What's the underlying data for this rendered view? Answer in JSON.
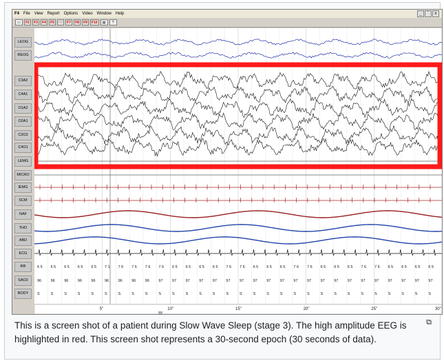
{
  "app": {
    "logo": "F4",
    "menu": [
      "File",
      "View",
      "Report",
      "Options",
      "Video",
      "Window",
      "Help"
    ],
    "window_controls": [
      "_",
      "´",
      "x"
    ],
    "toolbar": [
      {
        "label": "F2",
        "style": "red"
      },
      {
        "label": "F3",
        "style": "red"
      },
      {
        "label": "F4",
        "style": "red"
      },
      {
        "label": "F5",
        "style": "red"
      },
      {
        "label": "F6",
        "style": "gray"
      },
      {
        "label": "F7",
        "style": "red"
      },
      {
        "label": "F8",
        "style": "red"
      },
      {
        "label": "F9",
        "style": "red"
      },
      {
        "label": "F10",
        "style": "red"
      }
    ]
  },
  "channels": [
    {
      "label": "LEOG",
      "color": "#2233aa",
      "type": "eog"
    },
    {
      "label": "REOG",
      "color": "#2233aa",
      "type": "eog"
    },
    {
      "label": "C3A2",
      "color": "#111111",
      "type": "eeg"
    },
    {
      "label": "C4A1",
      "color": "#111111",
      "type": "eeg"
    },
    {
      "label": "O1A2",
      "color": "#111111",
      "type": "eeg"
    },
    {
      "label": "O2A1",
      "color": "#111111",
      "type": "eeg"
    },
    {
      "label": "C3O2",
      "color": "#111111",
      "type": "eeg"
    },
    {
      "label": "C4O1",
      "color": "#111111",
      "type": "eeg"
    },
    {
      "label": "LEMG",
      "color": "#111111",
      "type": "flat"
    },
    {
      "label": "MICRO",
      "color": "#111111",
      "type": "flat"
    },
    {
      "label": "IEMG",
      "color": "#aa2222",
      "type": "spikes"
    },
    {
      "label": "SCM",
      "color": "#aa2222",
      "type": "spikes"
    },
    {
      "label": "NAF",
      "color": "#9a1f1f",
      "type": "resp"
    },
    {
      "label": "THO",
      "color": "#2244aa",
      "type": "resp"
    },
    {
      "label": "ABD",
      "color": "#2244aa",
      "type": "resp"
    },
    {
      "label": "ECG",
      "color": "#111111",
      "type": "ecg"
    },
    {
      "label": "RR",
      "color": "#111111",
      "type": "text"
    },
    {
      "label": "SAO2",
      "color": "#111111",
      "type": "text"
    },
    {
      "label": "BODY",
      "color": "#111111",
      "type": "text"
    }
  ],
  "highlight": {
    "color": "#ff1a1a"
  },
  "rr_values": [
    "6 5",
    "6 5",
    "6 5",
    "6 5",
    "6 5",
    "7 1",
    "7 6",
    "7 6",
    "7 6",
    "7 6",
    "6 5",
    "6 5",
    "6 5",
    "6 5",
    "7 6",
    "7 6",
    "6 5",
    "6 5",
    "6 5",
    "7 6",
    "7 6",
    "6 5",
    "6 5",
    "6 5",
    "7 6",
    "7 6",
    "6 5",
    "6 5",
    "6 5",
    "6 5"
  ],
  "sao2_values": [
    "96",
    "96",
    "96",
    "96",
    "96",
    "96",
    "96",
    "96",
    "96",
    "97",
    "97",
    "97",
    "97",
    "97",
    "97",
    "97",
    "97",
    "97",
    "97",
    "97",
    "97",
    "97",
    "97",
    "97",
    "97",
    "97",
    "97",
    "97",
    "97",
    "97"
  ],
  "body_values": [
    "S",
    "S",
    "S",
    "S",
    "S",
    "S",
    "S",
    "S",
    "S",
    "S",
    "S",
    "S",
    "S",
    "S",
    "S",
    "S",
    "S",
    "S",
    "S",
    "S",
    "S",
    "S",
    "S",
    "S",
    "S",
    "S",
    "S",
    "S",
    "S",
    "S"
  ],
  "time_ticks": [
    "5\"",
    "10\"",
    "15\"",
    "20\"",
    "25\"",
    "30\""
  ],
  "caption": "This is a screen shot of a patient during Slow Wave Sleep (stage 3). The high amplitude EEG is highlighted in red. This screen shot represents a 30-second epoch (30 seconds of data)."
}
